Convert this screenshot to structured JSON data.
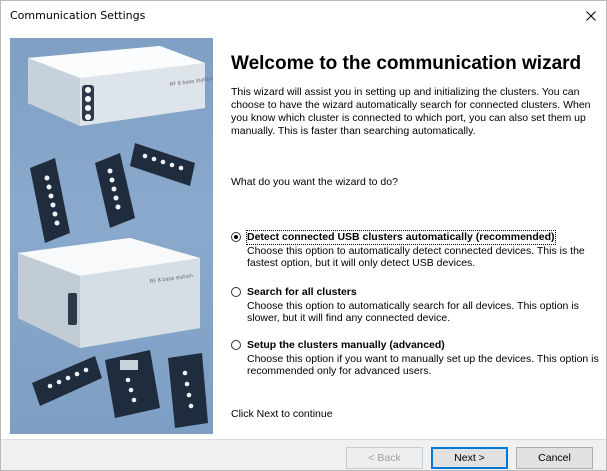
{
  "window": {
    "title": "Communication Settings",
    "close_icon": "close-icon"
  },
  "side_image": {
    "description_icon": "cluster-devices-illustration",
    "device_label_top": "RF 8 base station",
    "device_label_bottom": "RF 8 base station"
  },
  "main": {
    "heading": "Welcome to the communication wizard",
    "intro": "This wizard will assist you in setting up and initializing the clusters. You can choose to have the wizard automatically search for connected clusters. When you know which cluster is connected to which port, you can also set them up manually. This is faster than searching automatically.",
    "question": "What do you want the wizard to do?",
    "options": [
      {
        "label": "Detect connected USB clusters automatically (recommended)",
        "description": "Choose this option to automatically detect connected devices. This is the fastest option, but it will only detect USB devices.",
        "checked": true
      },
      {
        "label": "Search for all clusters",
        "description": "Choose this option to automatically search for all devices. This option is slower, but it will find any connected device.",
        "checked": false
      },
      {
        "label": "Setup the clusters manually (advanced)",
        "description": "Choose this option if you want to manually set up the devices. This option is recommended only for advanced users.",
        "checked": false
      }
    ],
    "footer": "Click Next to continue"
  },
  "buttons": {
    "back": "< Back",
    "next": "Next >",
    "cancel": "Cancel"
  }
}
